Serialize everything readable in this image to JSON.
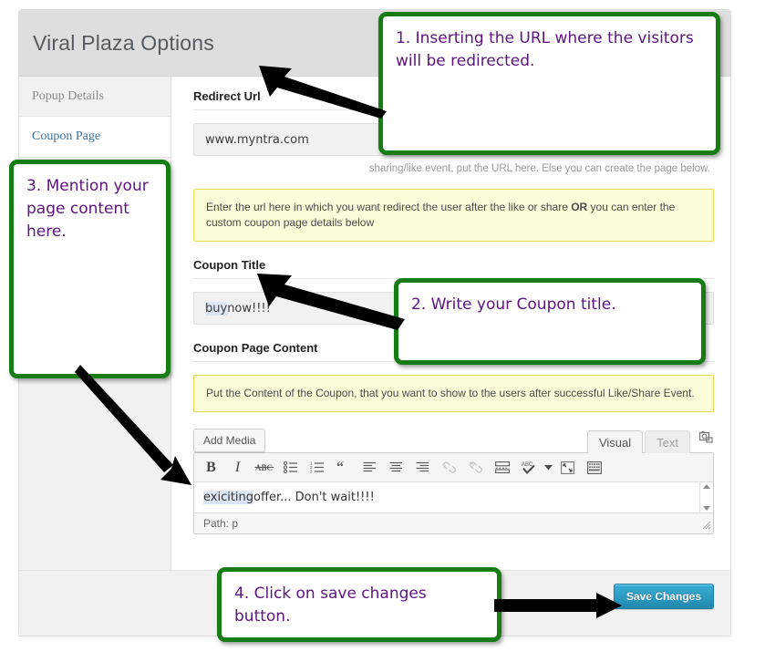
{
  "panel": {
    "title": "Viral Plaza Options"
  },
  "sidebar": {
    "items": [
      {
        "label": "Popup Details",
        "state": "inactive"
      },
      {
        "label": "Coupon Page",
        "state": "active"
      }
    ]
  },
  "form": {
    "redirect": {
      "label": "Redirect Url",
      "value": "www.myntra.com",
      "helper": "sharing/like event, put the URL here. Else you can create the page below.",
      "notice_before_bold": "Enter the url here in which you want redirect the user after the like or share ",
      "notice_bold": "OR",
      "notice_after_bold": " you can enter the custom coupon page details below"
    },
    "coupon_title": {
      "label": "Coupon Title",
      "value_highlighted": "buy",
      "value_rest": " now!!!!"
    },
    "coupon_content": {
      "label": "Coupon Page Content",
      "notice": "Put the Content of the Coupon, that you want to show to the users after successful Like/Share Event.",
      "add_media_label": "Add Media",
      "tabs": [
        {
          "label": "Visual",
          "state": "on"
        },
        {
          "label": "Text",
          "state": "off"
        }
      ],
      "body_highlighted": "exiciting",
      "body_rest": " offer... Don't wait!!!!",
      "path_label": "Path: p"
    }
  },
  "toolbar": {
    "buttons": [
      "bold-icon",
      "italic-icon",
      "strikethrough-icon",
      "bullet-list-icon",
      "numbered-list-icon",
      "blockquote-icon",
      "align-left-icon",
      "align-center-icon",
      "align-right-icon",
      "link-icon",
      "unlink-icon",
      "insert-more-tag-icon",
      "spellcheck-icon",
      "spellcheck-dropdown-icon",
      "fullscreen-icon",
      "kitchen-sink-icon"
    ]
  },
  "footer": {
    "save_label": "Save Changes"
  },
  "annotations": [
    {
      "id": 1,
      "text": "1. Inserting the URL where the visitors will be redirected."
    },
    {
      "id": 2,
      "text": "2. Write your Coupon title."
    },
    {
      "id": 3,
      "text": "3. Mention your page content here."
    },
    {
      "id": 4,
      "text": "4. Click on save changes button."
    }
  ],
  "colors": {
    "callout_border": "#167d16",
    "callout_text": "#5d1480",
    "arrow": "#000000",
    "save_button": "#2e9fca",
    "notice_bg": "#fdfcd8",
    "notice_border": "#e6db55",
    "spellcheck_highlight": "#dce6f4"
  }
}
